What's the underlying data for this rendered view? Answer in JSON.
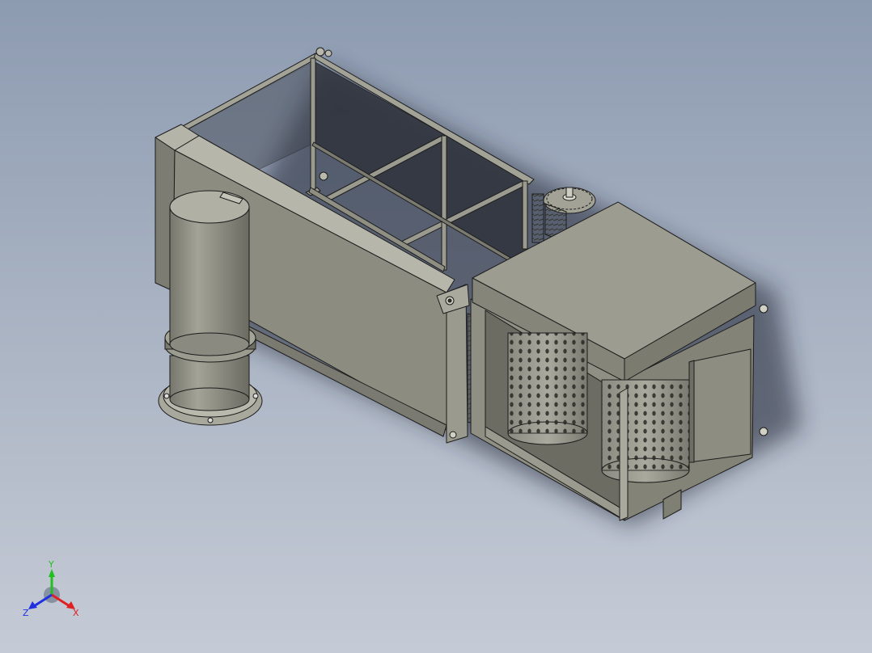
{
  "triad": {
    "x_label": "X",
    "y_label": "Y",
    "z_label": "Z",
    "x_color": "#e02020",
    "y_color": "#20c020",
    "z_color": "#2030e0"
  },
  "model": {
    "body_color": "#8e8e82",
    "edge_color": "#1c1c1c",
    "background_top": "#8d9bb1",
    "background_bottom": "#c5cbd6"
  }
}
